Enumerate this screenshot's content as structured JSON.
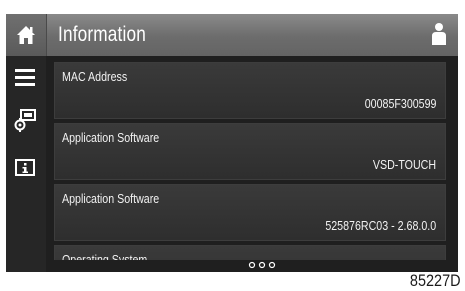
{
  "header": {
    "title": "Information",
    "home_icon": "home-icon",
    "user_icon": "user-icon"
  },
  "sidebar": {
    "items": [
      {
        "icon": "menu-icon"
      },
      {
        "icon": "controller-settings-icon"
      },
      {
        "icon": "info-icon"
      }
    ]
  },
  "rows": [
    {
      "label": "MAC Address",
      "value": "00085F300599"
    },
    {
      "label": "Application Software",
      "value": "VSD-TOUCH"
    },
    {
      "label": "Application Software",
      "value": "525876RC03 - 2.68.0.0"
    },
    {
      "label": "Operating System",
      "value": ""
    }
  ],
  "pager": {
    "icon": "more-dots-icon"
  },
  "figure_id": "85227D",
  "colors": {
    "header": "#777777",
    "background": "#1f1f1f",
    "row": "#343434",
    "text": "#f2f2f2"
  }
}
